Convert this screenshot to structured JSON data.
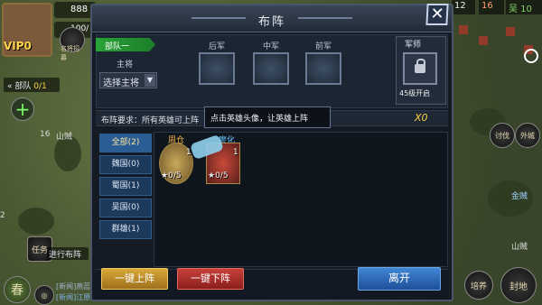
{
  "hud": {
    "vip": "VIP0",
    "gold": "888",
    "stamina": "100/",
    "squad_label": "部队",
    "squad_count": "0/1",
    "left_tag": "16",
    "mountain_label": "山贼",
    "num_2": "2",
    "recruit_label": "名将招募",
    "ongoing": "进行布阵",
    "mission_label": "任务",
    "spring": "春",
    "news_tag": "[新闻]",
    "news1": "燕蕊",
    "news2": "江原"
  },
  "right_hud": {
    "r1": "12",
    "r2": "16",
    "r3": "吴 10",
    "mountain": "山贼",
    "guild": "外城",
    "golden": "金贼",
    "train": "培养",
    "seal": "封地",
    "research": "讨伐"
  },
  "dialog": {
    "title": "布阵",
    "close": "✕",
    "team_tag": "部队一",
    "main_label": "主将",
    "select_main": "选择主将",
    "slot_rear": "后军",
    "slot_mid": "中军",
    "slot_front": "前军",
    "mil_label": "军师",
    "mil_open": "45级开启",
    "requirement": "布阵要求：所有英雄可上阵",
    "x_count": "X0",
    "tip": "点击英雄头像，让英雄上阵",
    "tabs": [
      {
        "label": "全部(2)",
        "active": true
      },
      {
        "label": "魏国(0)",
        "active": false
      },
      {
        "label": "蜀国(1)",
        "active": false
      },
      {
        "label": "吴国(0)",
        "active": false
      },
      {
        "label": "群雄(1)",
        "active": false
      }
    ],
    "heroes": [
      {
        "name": "周仓",
        "level": "1",
        "exp": "0/5"
      },
      {
        "name": "廖化",
        "level": "1",
        "exp": "0/5"
      }
    ],
    "btn_up": "一键上阵",
    "btn_down": "一键下阵",
    "btn_leave": "离开"
  }
}
